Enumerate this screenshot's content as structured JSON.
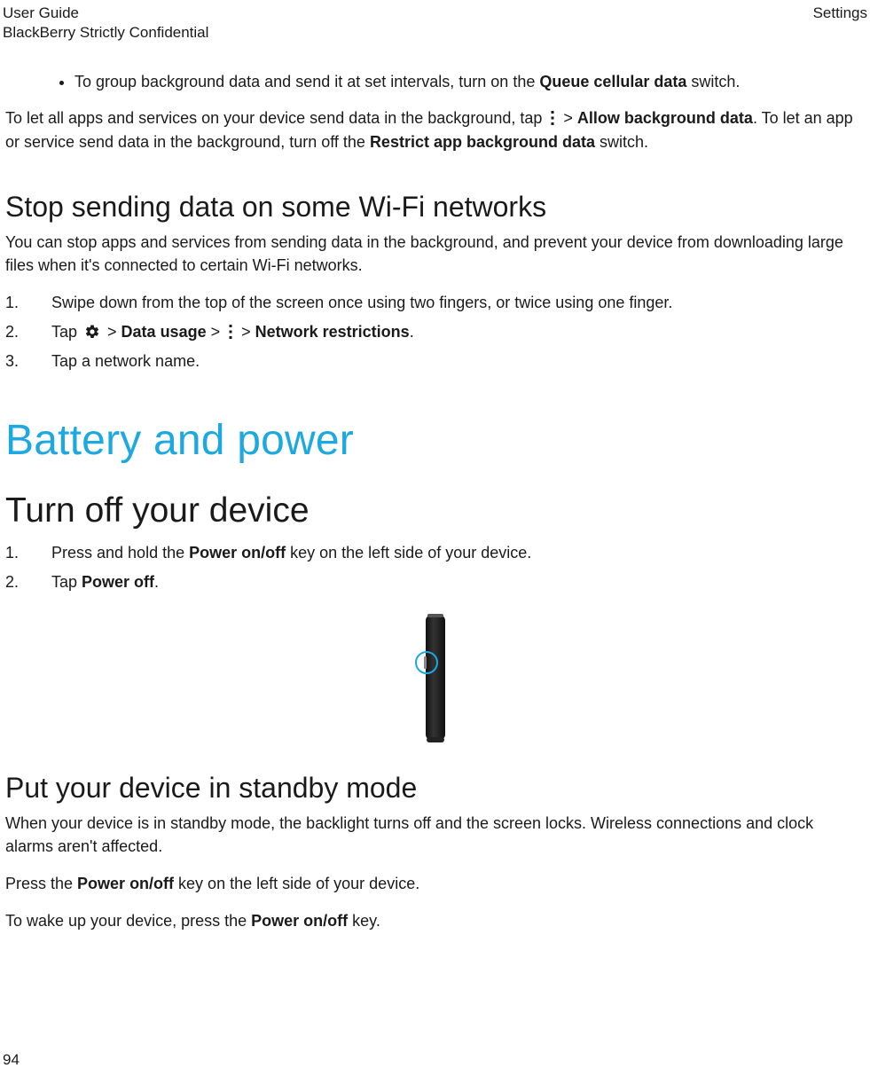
{
  "header": {
    "left_line1": "User Guide",
    "left_line2": "BlackBerry Strictly Confidential",
    "right": "Settings"
  },
  "bullet1_pre": "To group background data and send it at set intervals, turn on the ",
  "bullet1_bold": "Queue cellular data",
  "bullet1_post": " switch.",
  "para1": {
    "p1": "To let all apps and services on your device send data in the background, tap ",
    "gt1": " > ",
    "b1": "Allow background data",
    "p2": ". To let an app or service send data in the background, turn off the ",
    "b2": "Restrict app background data",
    "p3": " switch."
  },
  "h_stop": "Stop sending data on some Wi-Fi networks",
  "p_stop": "You can stop apps and services from sending data in the background, and prevent your device from downloading large files when it's connected to certain Wi-Fi networks.",
  "steps_wifi": {
    "s1": "Swipe down from the top of the screen once using two fingers, or twice using one finger.",
    "s2_pre": "Tap ",
    "gt": " > ",
    "s2_b1": "Data usage",
    "s2_mid": " > ",
    "s2_b2": "Network restrictions",
    "s2_post": ".",
    "s3": "Tap a network name."
  },
  "h_battery": "Battery and power",
  "h_turnoff": "Turn off your device",
  "steps_power": {
    "s1_pre": "Press and hold the ",
    "s1_b": "Power on/off",
    "s1_post": " key on the left side of your device.",
    "s2_pre": "Tap ",
    "s2_b": "Power off",
    "s2_post": "."
  },
  "h_standby": "Put your device in standby mode",
  "p_standby": "When your device is in standby mode, the backlight turns off and the screen locks. Wireless connections and clock alarms aren't affected.",
  "p_press": {
    "pre": "Press the ",
    "b": "Power on/off",
    "post": " key on the left side of your device."
  },
  "p_wake": {
    "pre": "To wake up your device, press the ",
    "b": "Power on/off",
    "post": " key."
  },
  "page_number": "94"
}
